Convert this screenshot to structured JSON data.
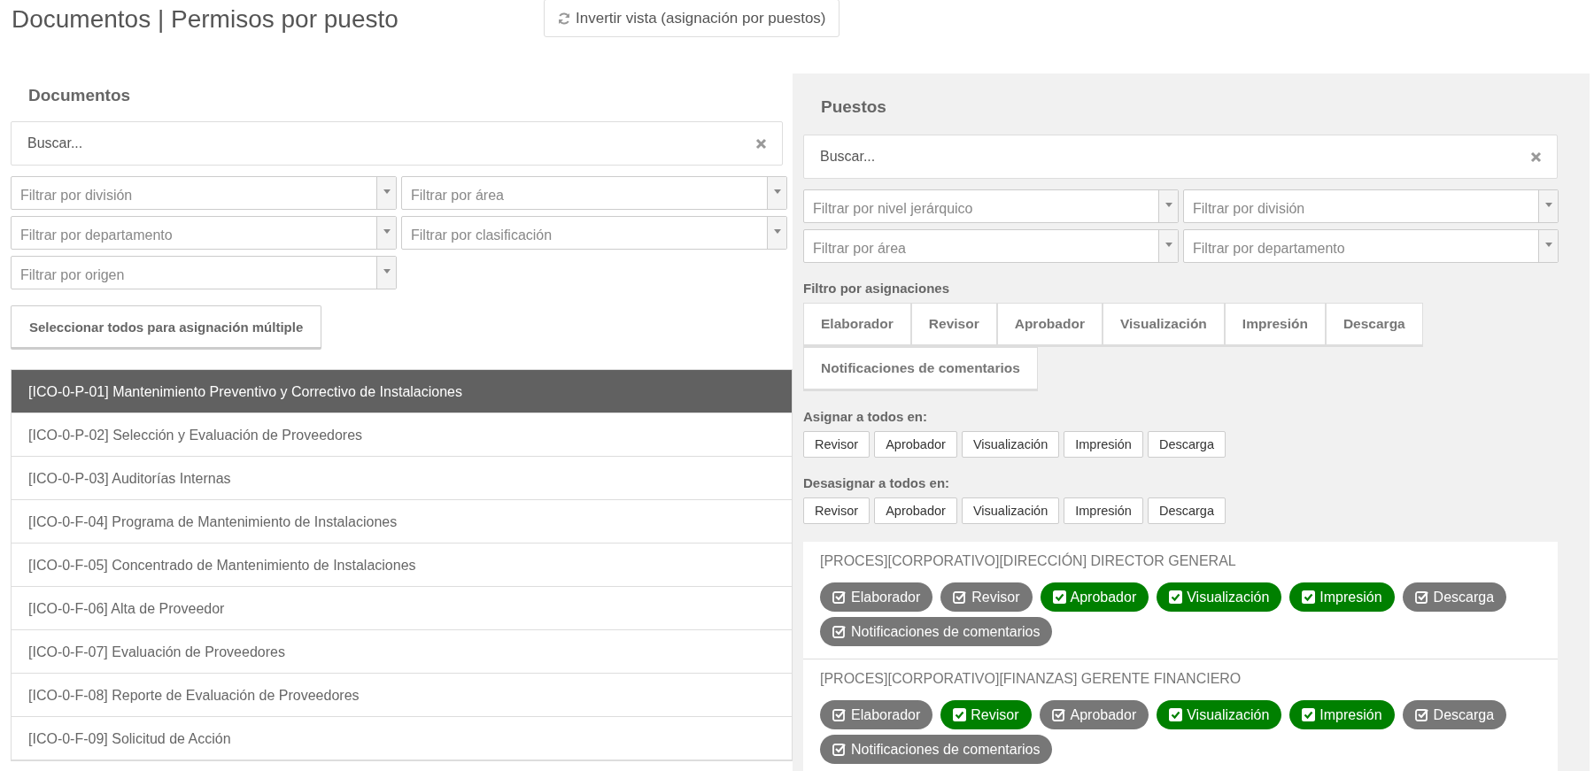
{
  "page_title": "Documentos | Permisos por puesto",
  "invert_button": "Invertir vista (asignación por puestos)",
  "documents": {
    "heading": "Documentos",
    "search": {
      "placeholder": "Buscar..."
    },
    "filters": [
      "Filtrar por división",
      "Filtrar por área",
      "Filtrar por departamento",
      "Filtrar por clasificación",
      "Filtrar por origen"
    ],
    "select_all_button": "Seleccionar todos para asignación múltiple",
    "items": [
      {
        "label": "[ICO-0-P-01] Mantenimiento Preventivo y Correctivo de Instalaciones",
        "selected": true
      },
      {
        "label": "[ICO-0-P-02] Selección y Evaluación de Proveedores",
        "selected": false
      },
      {
        "label": "[ICO-0-P-03] Auditorías Internas",
        "selected": false
      },
      {
        "label": "[ICO-0-F-04] Programa de Mantenimiento de Instalaciones",
        "selected": false
      },
      {
        "label": "[ICO-0-F-05] Concentrado de Mantenimiento de Instalaciones",
        "selected": false
      },
      {
        "label": "[ICO-0-F-06] Alta de Proveedor",
        "selected": false
      },
      {
        "label": "[ICO-0-F-07] Evaluación de Proveedores",
        "selected": false
      },
      {
        "label": "[ICO-0-F-08] Reporte de Evaluación de Proveedores",
        "selected": false
      },
      {
        "label": "[ICO-0-F-09] Solicitud de Acción",
        "selected": false
      }
    ]
  },
  "positions": {
    "heading": "Puestos",
    "search": {
      "placeholder": "Buscar..."
    },
    "filters": [
      "Filtrar por nivel jerárquico",
      "Filtrar por división",
      "Filtrar por área",
      "Filtrar por departamento"
    ],
    "assignment_filter_label": "Filtro por asignaciones",
    "assignment_filters": [
      "Elaborador",
      "Revisor",
      "Aprobador",
      "Visualización",
      "Impresión",
      "Descarga",
      "Notificaciones de comentarios"
    ],
    "assign_all_label": "Asignar a todos en:",
    "assign_all_buttons": [
      "Revisor",
      "Aprobador",
      "Visualización",
      "Impresión",
      "Descarga"
    ],
    "unassign_all_label": "Desasignar a todos en:",
    "unassign_all_buttons": [
      "Revisor",
      "Aprobador",
      "Visualización",
      "Impresión",
      "Descarga"
    ],
    "items": [
      {
        "title": "[PROCES][CORPORATIVO][DIRECCIÓN] DIRECTOR GENERAL",
        "permissions": [
          {
            "label": "Elaborador",
            "on": false
          },
          {
            "label": "Revisor",
            "on": false
          },
          {
            "label": "Aprobador",
            "on": true
          },
          {
            "label": "Visualización",
            "on": true
          },
          {
            "label": "Impresión",
            "on": true
          },
          {
            "label": "Descarga",
            "on": false
          },
          {
            "label": "Notificaciones de comentarios",
            "on": false
          }
        ]
      },
      {
        "title": "[PROCES][CORPORATIVO][FINANZAS] GERENTE FINANCIERO",
        "permissions": [
          {
            "label": "Elaborador",
            "on": false
          },
          {
            "label": "Revisor",
            "on": true
          },
          {
            "label": "Aprobador",
            "on": false
          },
          {
            "label": "Visualización",
            "on": true
          },
          {
            "label": "Impresión",
            "on": true
          },
          {
            "label": "Descarga",
            "on": false
          },
          {
            "label": "Notificaciones de comentarios",
            "on": false
          }
        ]
      }
    ]
  }
}
